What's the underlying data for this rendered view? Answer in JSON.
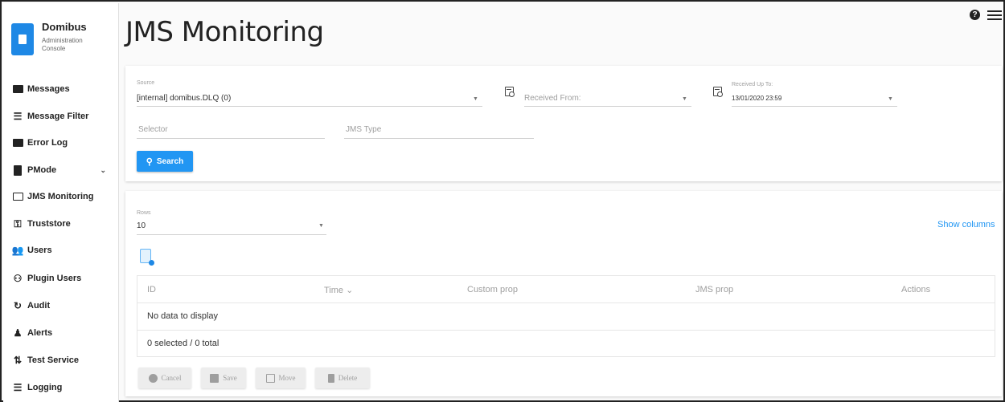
{
  "app": {
    "title": "Domibus",
    "subtitle": "Administration Console"
  },
  "page": {
    "title": "JMS Monitoring"
  },
  "sidebar": {
    "items": [
      {
        "label": "Messages",
        "icon": "message-icon"
      },
      {
        "label": "Message Filter",
        "icon": "filter-icon"
      },
      {
        "label": "Error Log",
        "icon": "error-log-icon"
      },
      {
        "label": "PMode",
        "icon": "document-icon",
        "chevron": "⌄"
      },
      {
        "label": "JMS Monitoring",
        "icon": "monitor-icon"
      },
      {
        "label": "Truststore",
        "icon": "key-icon"
      },
      {
        "label": "Users",
        "icon": "users-icon"
      },
      {
        "label": "Plugin Users",
        "icon": "plugin-users-icon"
      },
      {
        "label": "Audit",
        "icon": "audit-icon"
      },
      {
        "label": "Alerts",
        "icon": "bell-icon"
      },
      {
        "label": "Test Service",
        "icon": "swap-icon"
      },
      {
        "label": "Logging",
        "icon": "list-icon"
      }
    ]
  },
  "filters": {
    "source_label": "Source",
    "source_value": "[internal] domibus.DLQ (0)",
    "received_from_placeholder": "Received From:",
    "received_up_to_label": "Received Up To:",
    "received_up_to_value": "13/01/2020 23:59",
    "selector_placeholder": "Selector",
    "jms_type_placeholder": "JMS Type",
    "search_label": "Search"
  },
  "table": {
    "rows_label": "Rows",
    "rows_value": "10",
    "show_columns": "Show columns",
    "columns": [
      "ID",
      "Time ⌄",
      "Custom prop",
      "JMS prop",
      "Actions"
    ],
    "empty_message": "No data to display",
    "footer": "0 selected / 0 total"
  },
  "actions": {
    "cancel": "Cancel",
    "save": "Save",
    "move": "Move",
    "delete": "Delete"
  },
  "colors": {
    "accent": "#2196f3",
    "logo": "#1e88e5"
  }
}
